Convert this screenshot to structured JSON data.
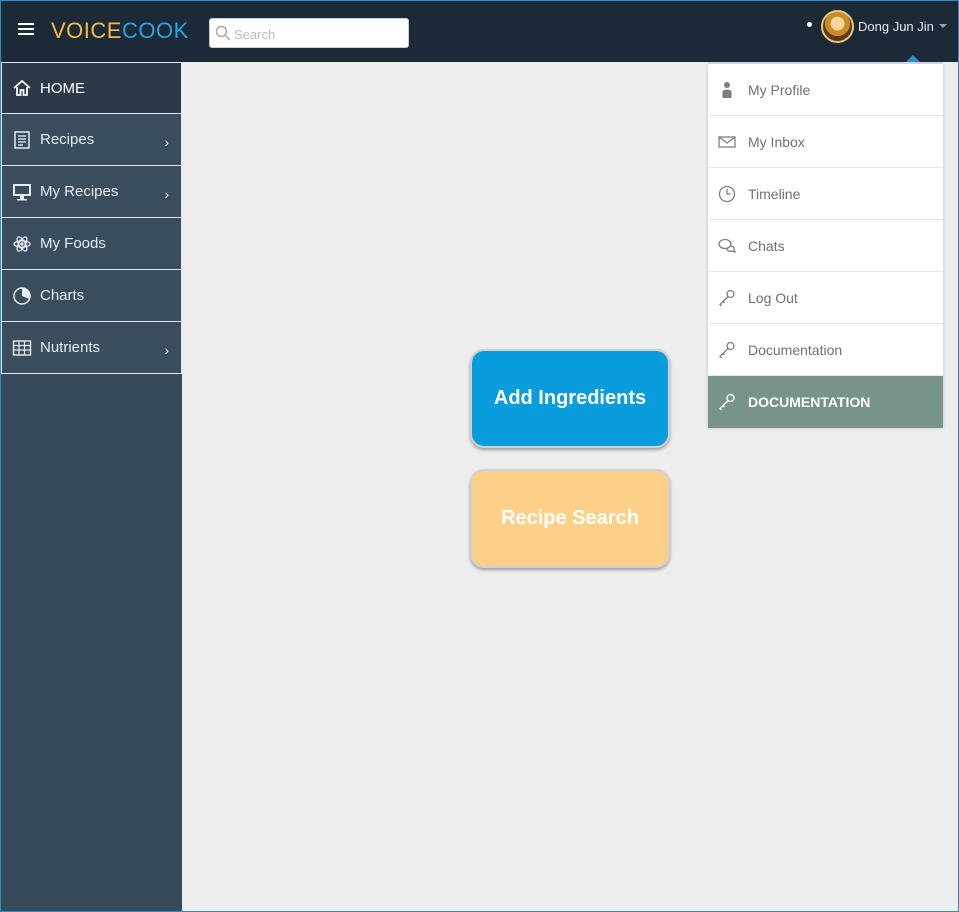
{
  "header": {
    "logo_part1": "VOICE",
    "logo_part2": "COOK",
    "search_placeholder": "Search",
    "user_name": "Dong Jun Jin"
  },
  "sidebar": {
    "items": [
      {
        "label": "HOME",
        "icon": "home-icon",
        "has_submenu": false
      },
      {
        "label": "Recipes",
        "icon": "document-icon",
        "has_submenu": true
      },
      {
        "label": "My Recipes",
        "icon": "monitor-icon",
        "has_submenu": true
      },
      {
        "label": "My Foods",
        "icon": "atom-icon",
        "has_submenu": false
      },
      {
        "label": "Charts",
        "icon": "pie-chart-icon",
        "has_submenu": false
      },
      {
        "label": "Nutrients",
        "icon": "grid-table-icon",
        "has_submenu": true
      }
    ],
    "chevron": "›"
  },
  "main": {
    "add_ingredients_label": "Add Ingredients",
    "recipe_search_label": "Recipe Search"
  },
  "user_dropdown": {
    "items": [
      {
        "label": "My Profile",
        "icon": "user-icon"
      },
      {
        "label": "My Inbox",
        "icon": "envelope-icon"
      },
      {
        "label": "Timeline",
        "icon": "clock-icon"
      },
      {
        "label": "Chats",
        "icon": "chat-bubbles-icon"
      },
      {
        "label": "Log Out",
        "icon": "key-icon"
      },
      {
        "label": "Documentation",
        "icon": "key-icon"
      },
      {
        "label": "DOCUMENTATION",
        "icon": "key-icon"
      }
    ]
  },
  "colors": {
    "topbar": "#1c2a38",
    "sidebar": "#364a5a",
    "add_ingredients_bg": "#0a9ddd",
    "recipe_search_bg": "#fdd08a",
    "dropdown_active_bg": "#77948a",
    "logo_voice": "#f5b94a",
    "logo_cook": "#2aa3e0"
  }
}
